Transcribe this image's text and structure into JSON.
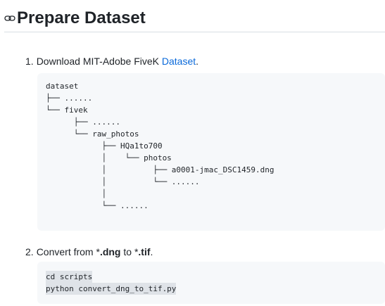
{
  "heading": {
    "anchor_icon": "link-icon",
    "title": "Prepare Dataset"
  },
  "steps": [
    {
      "number": "1.",
      "text_before": "Download MIT-Adobe FiveK ",
      "link_text": "Dataset",
      "text_after": "."
    },
    {
      "number": "2.",
      "text_a": "Convert from *",
      "bold_a": ".dng",
      "text_b": " to *",
      "bold_b": ".tif",
      "text_c": "."
    }
  ],
  "tree_lines": [
    "dataset",
    "├── ......",
    "└── fivek",
    "      ├── ......",
    "      └── raw_photos",
    "            ├── HQa1to700",
    "            │    └── photos",
    "            │          ├── a0001-jmac_DSC1459.dng",
    "            │          └── ......",
    "            │",
    "            └── ......"
  ],
  "commands": [
    "cd scripts",
    "python convert_dng_to_tif.py"
  ],
  "colors": {
    "link": "#0969da",
    "code_background": "#f6f8fa",
    "text": "#1f2328"
  }
}
